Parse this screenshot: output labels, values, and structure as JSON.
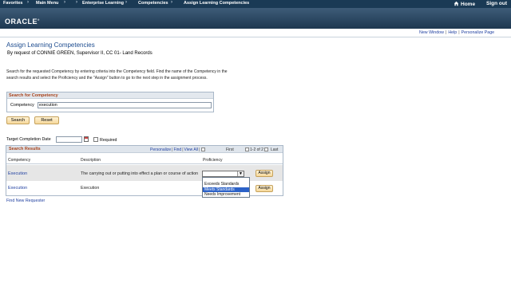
{
  "topnav": {
    "items": [
      "Favorites",
      "Main Menu",
      "Enterprise Learning",
      "Competencies",
      "Assign Learning Competencies"
    ],
    "home": "Home",
    "signout": "Sign out"
  },
  "banner": {
    "logo": "ORACLE"
  },
  "pagelinks": {
    "new_window": "New Window",
    "help": "Help",
    "personalize": "Personalize Page"
  },
  "page": {
    "title": "Assign Learning Competencies",
    "subtitle": "By request of CONNIE GREEN, Supervisor II, CC 01- Land Records",
    "instructions": "Search for the requested Competency by entering criteria into the Competency field. Find the name of the Competency in the search results and select the Proficiency and the \"Assign\" button to go to the next step in the assignment process."
  },
  "search": {
    "header": "Search for Competency",
    "competency_label": "Competency",
    "competency_value": "execution",
    "search_button": "Search",
    "reset_button": "Reset"
  },
  "target": {
    "label": "Target Completion Date",
    "value": "",
    "required_label": "Required"
  },
  "results": {
    "header": "Search Results",
    "nav": {
      "personalize": "Personalize",
      "find": "Find",
      "view_all": "View All",
      "first": "First",
      "count": "1-2 of 2",
      "last": "Last"
    },
    "columns": [
      "Competency",
      "Description",
      "Proficiency"
    ],
    "rows": [
      {
        "competency": "Execution",
        "description": "The carrying out or putting into effect a plan or course of action",
        "proficiency": "",
        "assign": "Assign"
      },
      {
        "competency": "Execution",
        "description": "Execution",
        "proficiency": "",
        "assign": "Assign"
      }
    ]
  },
  "proficiency_options": [
    "",
    "Exceeds Standards",
    "Meets Standards",
    "Needs Improvement"
  ],
  "proficiency_highlighted": "Meets Standards",
  "find_new_requester": "Find New Requester",
  "colors": {
    "nav_bg": "#1a3a55",
    "banner": "#2a4660",
    "link": "#1f3fa0",
    "group_header": "#a8421a",
    "highlight": "#2c62c8"
  }
}
